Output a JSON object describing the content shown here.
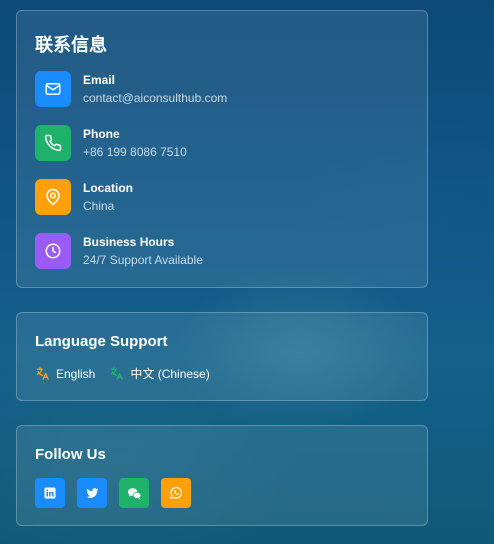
{
  "contact": {
    "title": "联系信息",
    "items": [
      {
        "label": "Email",
        "value": "contact@aiconsulthub.com",
        "icon": "mail-icon",
        "color": "#1a8cff"
      },
      {
        "label": "Phone",
        "value": "+86 199 8086 7510",
        "icon": "phone-icon",
        "color": "#1fb26b"
      },
      {
        "label": "Location",
        "value": "China",
        "icon": "map-pin-icon",
        "color": "#ff9f0a"
      },
      {
        "label": "Business Hours",
        "value": "24/7 Support Available",
        "icon": "clock-icon",
        "color": "#9b5cf6"
      }
    ]
  },
  "language": {
    "title": "Language Support",
    "items": [
      {
        "label": "English",
        "icon": "translate-icon",
        "color": "#ff9f0a"
      },
      {
        "label": "中文 (Chinese)",
        "icon": "translate-icon",
        "color": "#1fb26b"
      }
    ]
  },
  "follow": {
    "title": "Follow Us",
    "socials": [
      {
        "name": "linkedin-icon",
        "color": "#1a8cff"
      },
      {
        "name": "twitter-icon",
        "color": "#1a8cff"
      },
      {
        "name": "wechat-icon",
        "color": "#1fb26b"
      },
      {
        "name": "whatsapp-icon",
        "color": "#ff9f0a"
      }
    ]
  }
}
